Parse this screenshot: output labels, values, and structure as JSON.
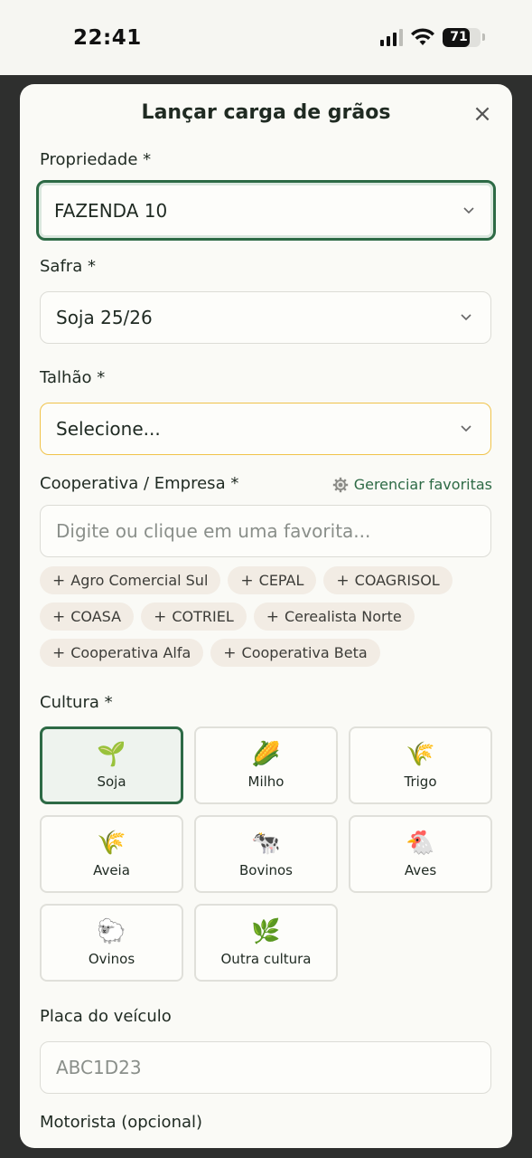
{
  "status_bar": {
    "time": "22:41",
    "battery": "71",
    "battery_level": 0.71
  },
  "sheet": {
    "title": "Lançar carga de grãos"
  },
  "propriedade": {
    "label": "Propriedade *",
    "value": "FAZENDA 10"
  },
  "safra": {
    "label": "Safra *",
    "value": "Soja 25/26"
  },
  "talhao": {
    "label": "Talhão *",
    "value": "Selecione..."
  },
  "cooperativa": {
    "label": "Cooperativa / Empresa *",
    "manage_label": "Gerenciar favoritas",
    "placeholder": "Digite ou clique em uma favorita...",
    "favorites": [
      "Agro Comercial Sul",
      "CEPAL",
      "COAGRISOL",
      "COASA",
      "COTRIEL",
      "Cerealista Norte",
      "Cooperativa Alfa",
      "Cooperativa Beta"
    ]
  },
  "cultura": {
    "label": "Cultura *",
    "options": [
      {
        "emoji": "🌱",
        "name": "Soja"
      },
      {
        "emoji": "🌽",
        "name": "Milho"
      },
      {
        "emoji": "🌾",
        "name": "Trigo"
      },
      {
        "emoji": "🌾",
        "name": "Aveia"
      },
      {
        "emoji": "🐄",
        "name": "Bovinos"
      },
      {
        "emoji": "🐔",
        "name": "Aves"
      },
      {
        "emoji": "🐑",
        "name": "Ovinos"
      },
      {
        "emoji": "🌿",
        "name": "Outra cultura"
      }
    ],
    "selected": "Soja"
  },
  "placa": {
    "label": "Placa do veículo",
    "placeholder": "ABC1D23"
  },
  "motorista": {
    "label": "Motorista (opcional)"
  },
  "colors": {
    "accent": "#2d6a45",
    "warning": "#f0c34a",
    "chip_bg": "#f2ece4"
  }
}
